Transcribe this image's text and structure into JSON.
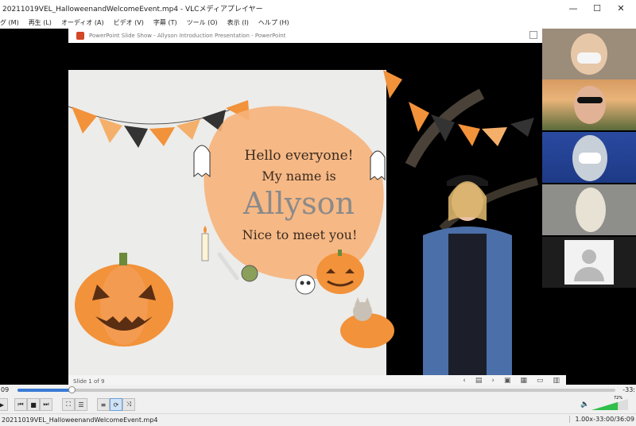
{
  "window": {
    "title": "20211019VEL_HalloweenandWelcomeEvent.mp4 - VLCメディアプレイヤー",
    "minimize": "—",
    "maximize": "☐",
    "close": "✕"
  },
  "menu": [
    "グ (M)",
    "再生 (L)",
    "オーディオ (A)",
    "ビデオ (V)",
    "字幕 (T)",
    "ツール (O)",
    "表示 (I)",
    "ヘルプ (H)"
  ],
  "ppt": {
    "title": "PowerPoint Slide Show  -  Allyson Introduction Presentation - PowerPoint",
    "slide_number": "Slide 1 of 9",
    "nav_prev": "‹",
    "nav_next": "›"
  },
  "slide": {
    "line1": "Hello everyone!",
    "line2": "My name is",
    "name": "Allyson",
    "line3": "Nice to meet you!"
  },
  "player": {
    "elapsed": "09",
    "remaining": "-33:",
    "progress": 0.09,
    "filename": "20211019VEL_HalloweenandWelcomeEvent.mp4",
    "speed": "1.00x",
    "time_display": "-33:00/36:09",
    "volume_label": "72%",
    "volume_level": 0.72
  },
  "colors": {
    "accent": "#f4a261",
    "pumpkin": "#f2923a",
    "blob": "#f7b37a",
    "name_text": "#8a8a8a",
    "seek": "#3a7bd5"
  }
}
